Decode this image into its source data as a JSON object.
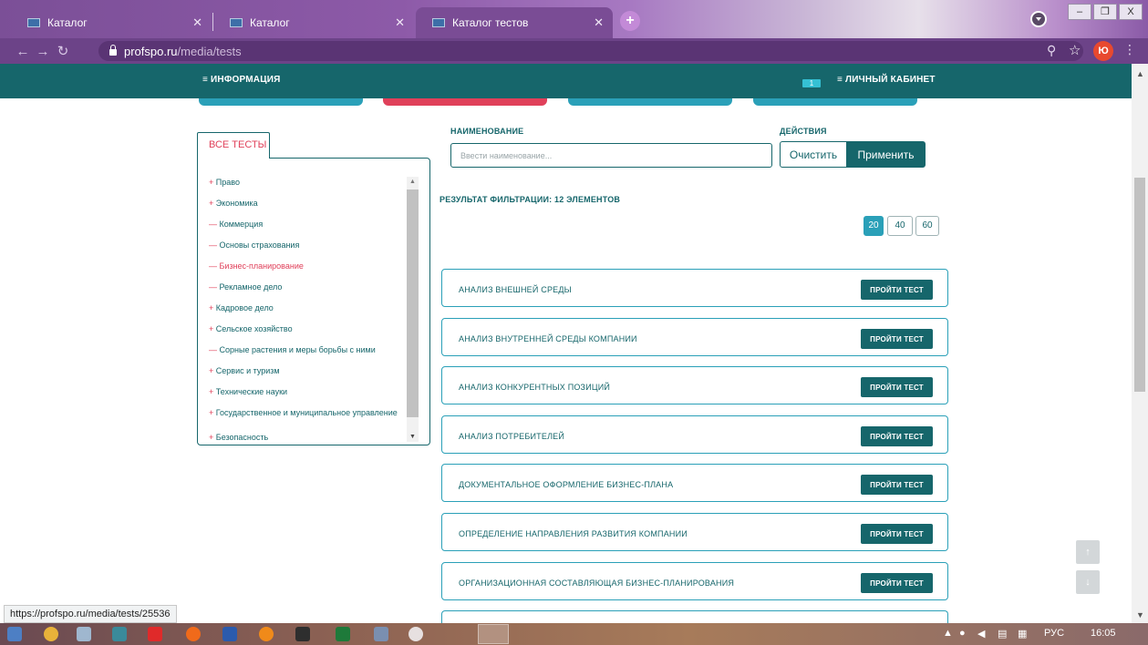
{
  "browser": {
    "tabs": [
      {
        "title": "Каталог",
        "active": false
      },
      {
        "title": "Каталог",
        "active": false
      },
      {
        "title": "Каталог тестов",
        "active": true
      }
    ],
    "new_tab": "+",
    "url_host": "profspo.ru",
    "url_path": "/media/tests",
    "avatar_letter": "Ю",
    "window_buttons": [
      "–",
      "❐",
      "X"
    ]
  },
  "site_nav": {
    "info_label": "≡ ИНФОРМАЦИЯ",
    "notifications_count": "1",
    "cabinet_label": "≡ ЛИЧНЫЙ КАБИНЕТ"
  },
  "sidebar": {
    "tab_label": "ВСЕ ТЕСТЫ",
    "items": [
      {
        "marker": "+",
        "label": "Право",
        "active": false
      },
      {
        "marker": "+",
        "label": "Экономика",
        "active": false
      },
      {
        "marker": "—",
        "label": "Коммерция",
        "active": false
      },
      {
        "marker": "—",
        "label": "Основы страхования",
        "active": false
      },
      {
        "marker": "—",
        "label": "Бизнес-планирование",
        "active": true
      },
      {
        "marker": "—",
        "label": "Рекламное дело",
        "active": false
      },
      {
        "marker": "+",
        "label": "Кадровое дело",
        "active": false
      },
      {
        "marker": "+",
        "label": "Сельское хозяйство",
        "active": false
      },
      {
        "marker": "—",
        "label": "Сорные растения и меры борьбы с ними",
        "active": false
      },
      {
        "marker": "+",
        "label": "Сервис и туризм",
        "active": false
      },
      {
        "marker": "+",
        "label": "Технические науки",
        "active": false
      },
      {
        "marker": "+",
        "label": "Государственное и муниципальное управление",
        "active": false
      },
      {
        "marker": "+",
        "label": "Безопасность",
        "active": false
      }
    ]
  },
  "filter": {
    "name_label": "НАИМЕНОВАНИЕ",
    "actions_label": "ДЕЙСТВИЯ",
    "search_placeholder": "Ввести наименование...",
    "search_value": "",
    "clear_label": "Очистить",
    "apply_label": "Применить",
    "result_text": "РЕЗУЛЬТАТ ФИЛЬТРАЦИИ: 12 ЭЛЕМЕНТОВ"
  },
  "pagination": {
    "per_page_options": [
      "20",
      "40",
      "60"
    ],
    "selected": "20"
  },
  "tests": {
    "button_label": "ПРОЙТИ ТЕСТ",
    "items": [
      "АНАЛИЗ ВНЕШНЕЙ СРЕДЫ",
      "АНАЛИЗ ВНУТРЕННЕЙ СРЕДЫ КОМПАНИИ",
      "АНАЛИЗ КОНКУРЕНТНЫХ ПОЗИЦИЙ",
      "АНАЛИЗ ПОТРЕБИТЕЛЕЙ",
      "ДОКУМЕНТАЛЬНОЕ ОФОРМЛЕНИЕ БИЗНЕС-ПЛАНА",
      "ОПРЕДЕЛЕНИЕ НАПРАВЛЕНИЯ РАЗВИТИЯ КОМПАНИИ",
      "ОРГАНИЗАЦИОННАЯ СОСТАВЛЯЮЩАЯ БИЗНЕС-ПЛАНИРОВАНИЯ"
    ]
  },
  "scroll_buttons": {
    "up": "↑",
    "down": "↓"
  },
  "status_url": "https://profspo.ru/media/tests/25536",
  "taskbar": {
    "language": "РУС",
    "time": "16:05"
  },
  "colors": {
    "primary": "#16666b",
    "accent": "#e0405a",
    "cyan": "#2aa0b8"
  }
}
